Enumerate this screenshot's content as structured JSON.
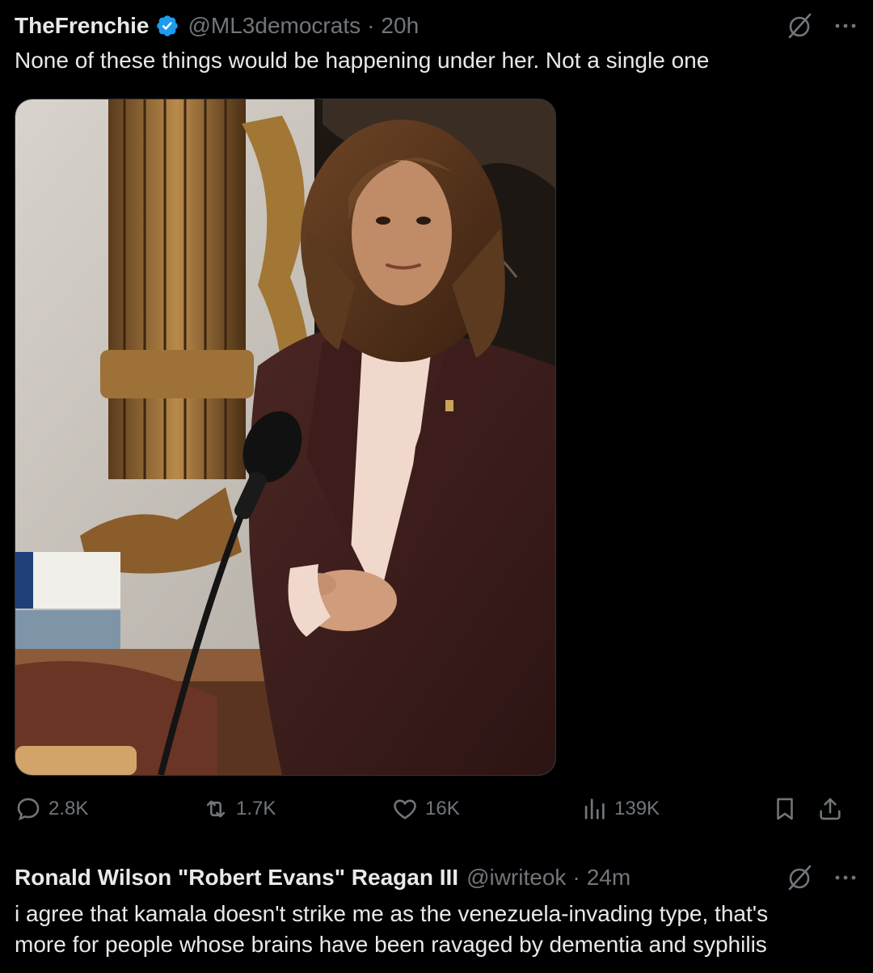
{
  "post1": {
    "display_name": "TheFrenchie",
    "handle": "@ML3democrats",
    "separator": "·",
    "time": "20h",
    "text": "None of these things would be happening under her. Not a single one",
    "stats": {
      "replies": "2.8K",
      "reposts": "1.7K",
      "likes": "16K",
      "views": "139K"
    }
  },
  "post2": {
    "display_name": "Ronald Wilson \"Robert Evans\" Reagan III",
    "handle": "@iwriteok",
    "separator": "·",
    "time": "24m",
    "text_line1": "i agree that kamala doesn't strike me as the venezuela-invading type, that's",
    "text_line2": "more for people whose brains have been ravaged by dementia and syphilis"
  },
  "colors": {
    "background": "#000000",
    "text": "#e7e9ea",
    "muted": "#71767b",
    "verified": "#1d9bf0"
  },
  "icons": {
    "verified": "verified-badge-icon",
    "grok": "grok-icon",
    "more": "more-options-icon",
    "reply": "reply-icon",
    "repost": "repost-icon",
    "like": "like-icon",
    "views": "views-icon",
    "bookmark": "bookmark-icon",
    "share": "share-icon"
  }
}
